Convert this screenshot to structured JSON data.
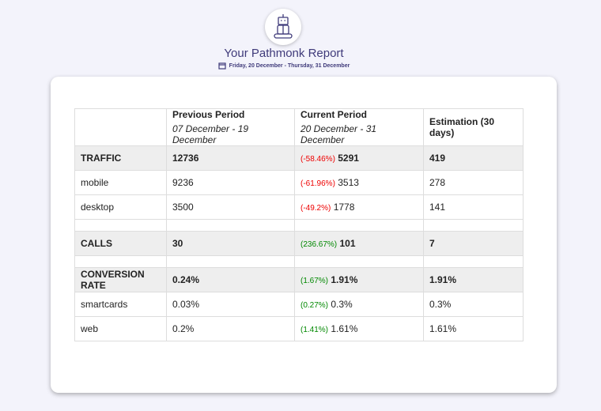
{
  "header": {
    "title": "Your Pathmonk Report",
    "date_range": "Friday, 20 December - Thursday, 31 December",
    "logo": "monk-robot-icon",
    "calendar_icon": "calendar-icon"
  },
  "table": {
    "columns": [
      {
        "label": ""
      },
      {
        "label": "Previous Period",
        "sub": "07 December - 19 December"
      },
      {
        "label": "Current Period",
        "sub": "20 December - 31 December"
      },
      {
        "label": "Estimation (30 days)"
      }
    ],
    "rows": [
      {
        "label": "TRAFFIC",
        "prev": "12736",
        "change": "(-58.46%)",
        "current": "5291",
        "est": "419",
        "section": true,
        "trend": "neg"
      },
      {
        "label": "mobile",
        "prev": "9236",
        "change": "(-61.96%)",
        "current": "3513",
        "est": "278",
        "trend": "neg"
      },
      {
        "label": "desktop",
        "prev": "3500",
        "change": "(-49.2%)",
        "current": "1778",
        "est": "141",
        "trend": "neg"
      },
      {
        "spacer": true
      },
      {
        "label": "CALLS",
        "prev": "30",
        "change": "(236.67%)",
        "current": "101",
        "est": "7",
        "section": true,
        "trend": "pos"
      },
      {
        "spacer": true
      },
      {
        "label": "CONVERSION RATE",
        "prev": "0.24%",
        "change": "(1.67%)",
        "current": "1.91%",
        "est": "1.91%",
        "section": true,
        "trend": "pos"
      },
      {
        "label": "smartcards",
        "prev": "0.03%",
        "change": "(0.27%)",
        "current": "0.3%",
        "est": "0.3%",
        "trend": "pos"
      },
      {
        "label": "web",
        "prev": "0.2%",
        "change": "(1.41%)",
        "current": "1.61%",
        "est": "1.61%",
        "trend": "pos"
      }
    ]
  },
  "colors": {
    "negative": "#ee0000",
    "positive": "#008800",
    "title": "#3f3a7a"
  }
}
